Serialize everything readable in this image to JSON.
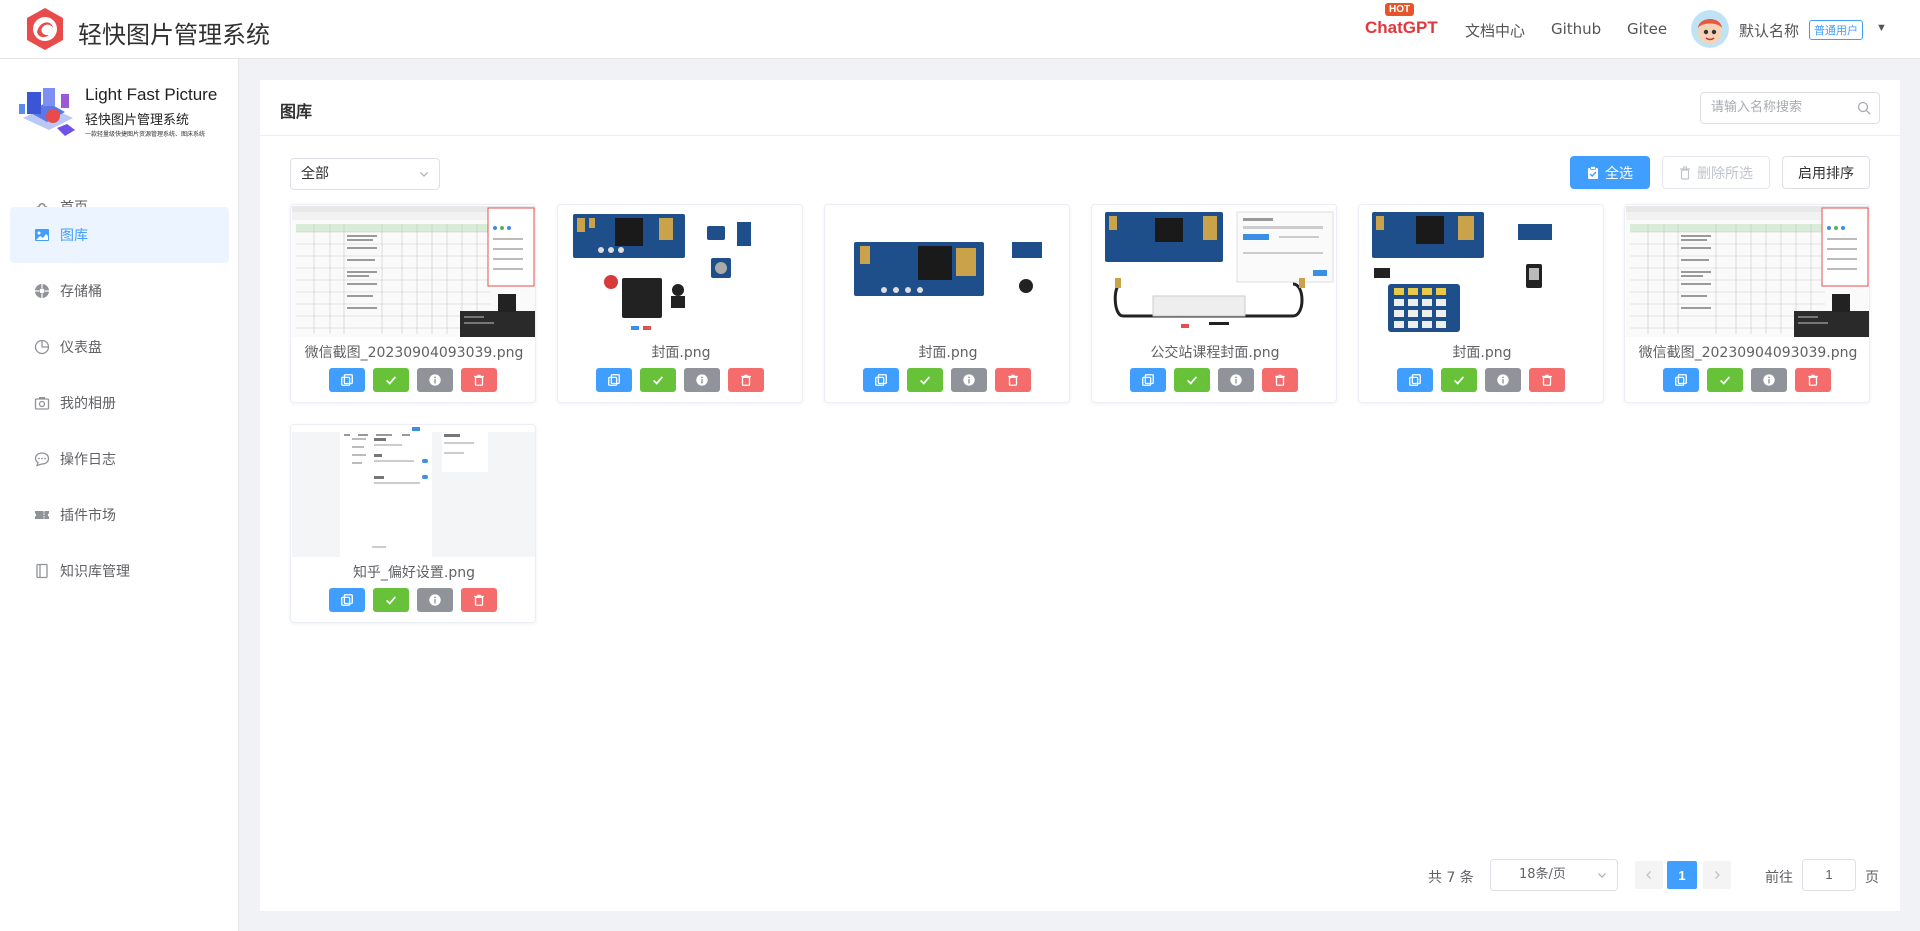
{
  "header": {
    "app_title": "轻快图片管理系统",
    "hot_badge": "HOT",
    "chatgpt": "ChatGPT",
    "nav_docs": "文档中心",
    "nav_github": "Github",
    "nav_gitee": "Gitee",
    "username": "默认名称",
    "user_role": "普通用户"
  },
  "sidebar": {
    "logo_title": "Light Fast Picture",
    "logo_subtitle": "轻快图片管理系统",
    "logo_tagline": "一款轻量级快捷图片资源管理系统、图床系统",
    "items": [
      {
        "label": "首页",
        "icon": "cloud-upload-icon"
      },
      {
        "label": "图库",
        "icon": "image-icon",
        "active": true
      },
      {
        "label": "存储桶",
        "icon": "bucket-icon"
      },
      {
        "label": "仪表盘",
        "icon": "pie-chart-icon"
      },
      {
        "label": "我的相册",
        "icon": "camera-icon"
      },
      {
        "label": "操作日志",
        "icon": "chat-icon"
      },
      {
        "label": "插件市场",
        "icon": "ticket-icon"
      },
      {
        "label": "知识库管理",
        "icon": "notebook-icon"
      }
    ]
  },
  "main": {
    "title": "图库",
    "search_placeholder": "请输入名称搜索",
    "filter_value": "全部",
    "select_all": "全选",
    "delete_selected": "删除所选",
    "enable_sort": "启用排序",
    "cards": [
      {
        "name": "微信截图_20230904093039.png",
        "thumb": "spreadsheet"
      },
      {
        "name": "封面.png",
        "thumb": "board-a"
      },
      {
        "name": "封面.png",
        "thumb": "board-b"
      },
      {
        "name": "公交站课程封面.png",
        "thumb": "board-c"
      },
      {
        "name": "封面.png",
        "thumb": "board-d"
      },
      {
        "name": "微信截图_20230904093039.png",
        "thumb": "spreadsheet"
      },
      {
        "name": "知乎_偏好设置.png",
        "thumb": "settings"
      }
    ]
  },
  "pagination": {
    "total": "共 7 条",
    "page_size": "18条/页",
    "current_page": "1",
    "goto_label": "前往",
    "goto_value": "1",
    "page_suffix": "页"
  },
  "colors": {
    "primary": "#409eff",
    "success": "#67c23a",
    "info": "#909399",
    "danger": "#f56c6c",
    "chatgpt_red": "#e2373f"
  }
}
